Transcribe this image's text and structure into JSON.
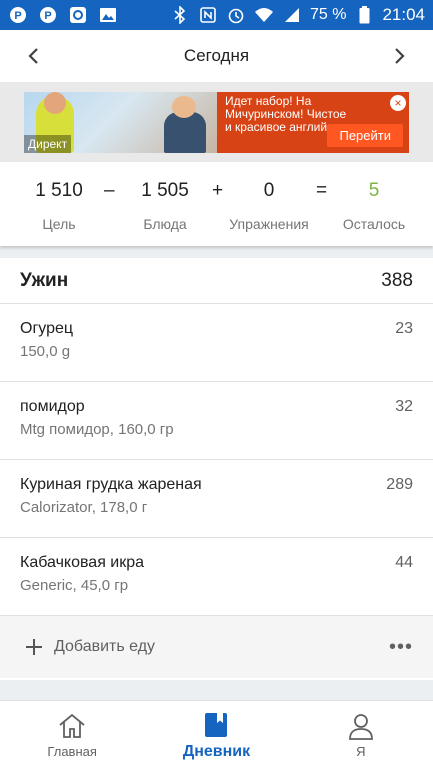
{
  "status_bar": {
    "battery": "75 %",
    "time": "21:04",
    "left_icons": [
      "pinterest-icon",
      "pinterest-icon",
      "fitness-app-icon",
      "image-icon"
    ],
    "right_icons": [
      "bluetooth-icon",
      "nfc-icon",
      "alarm-icon",
      "wifi-icon",
      "signal-icon",
      "battery-icon"
    ],
    "color": "#1565c0"
  },
  "header": {
    "title": "Сегодня"
  },
  "ad": {
    "tag": "Директ",
    "text": "Идет набор! На Мичуринском! Чистое и красивое английск...",
    "button": "Перейти",
    "close": "×",
    "color": "#d84315"
  },
  "summary": {
    "goal": {
      "value": "1 510",
      "label": "Цель"
    },
    "op1": "–",
    "food": {
      "value": "1 505",
      "label": "Блюда"
    },
    "op2": "+",
    "exercise": {
      "value": "0",
      "label": "Упражнения"
    },
    "op3": "=",
    "remaining": {
      "value": "5",
      "label": "Осталось",
      "color": "#7cb342"
    }
  },
  "meal": {
    "title": "Ужин",
    "total": "388",
    "items": [
      {
        "name": "Огурец",
        "desc": "150,0 g",
        "cal": "23"
      },
      {
        "name": "помидор",
        "desc": "Mtg помидор, 160,0 гр",
        "cal": "32"
      },
      {
        "name": "Куриная грудка жареная",
        "desc": "Calorizator, 178,0 г",
        "cal": "289"
      },
      {
        "name": "Кабачковая икра",
        "desc": "Generic, 45,0 гр",
        "cal": "44"
      }
    ],
    "add_label": "Добавить еду",
    "more": "•••"
  },
  "bottom_nav": {
    "tabs": [
      {
        "label": "Главная",
        "icon": "home-icon"
      },
      {
        "label": "Дневник",
        "icon": "diary-icon"
      },
      {
        "label": "Я",
        "icon": "profile-icon"
      }
    ],
    "active_index": 1,
    "accent": "#1565c0"
  }
}
